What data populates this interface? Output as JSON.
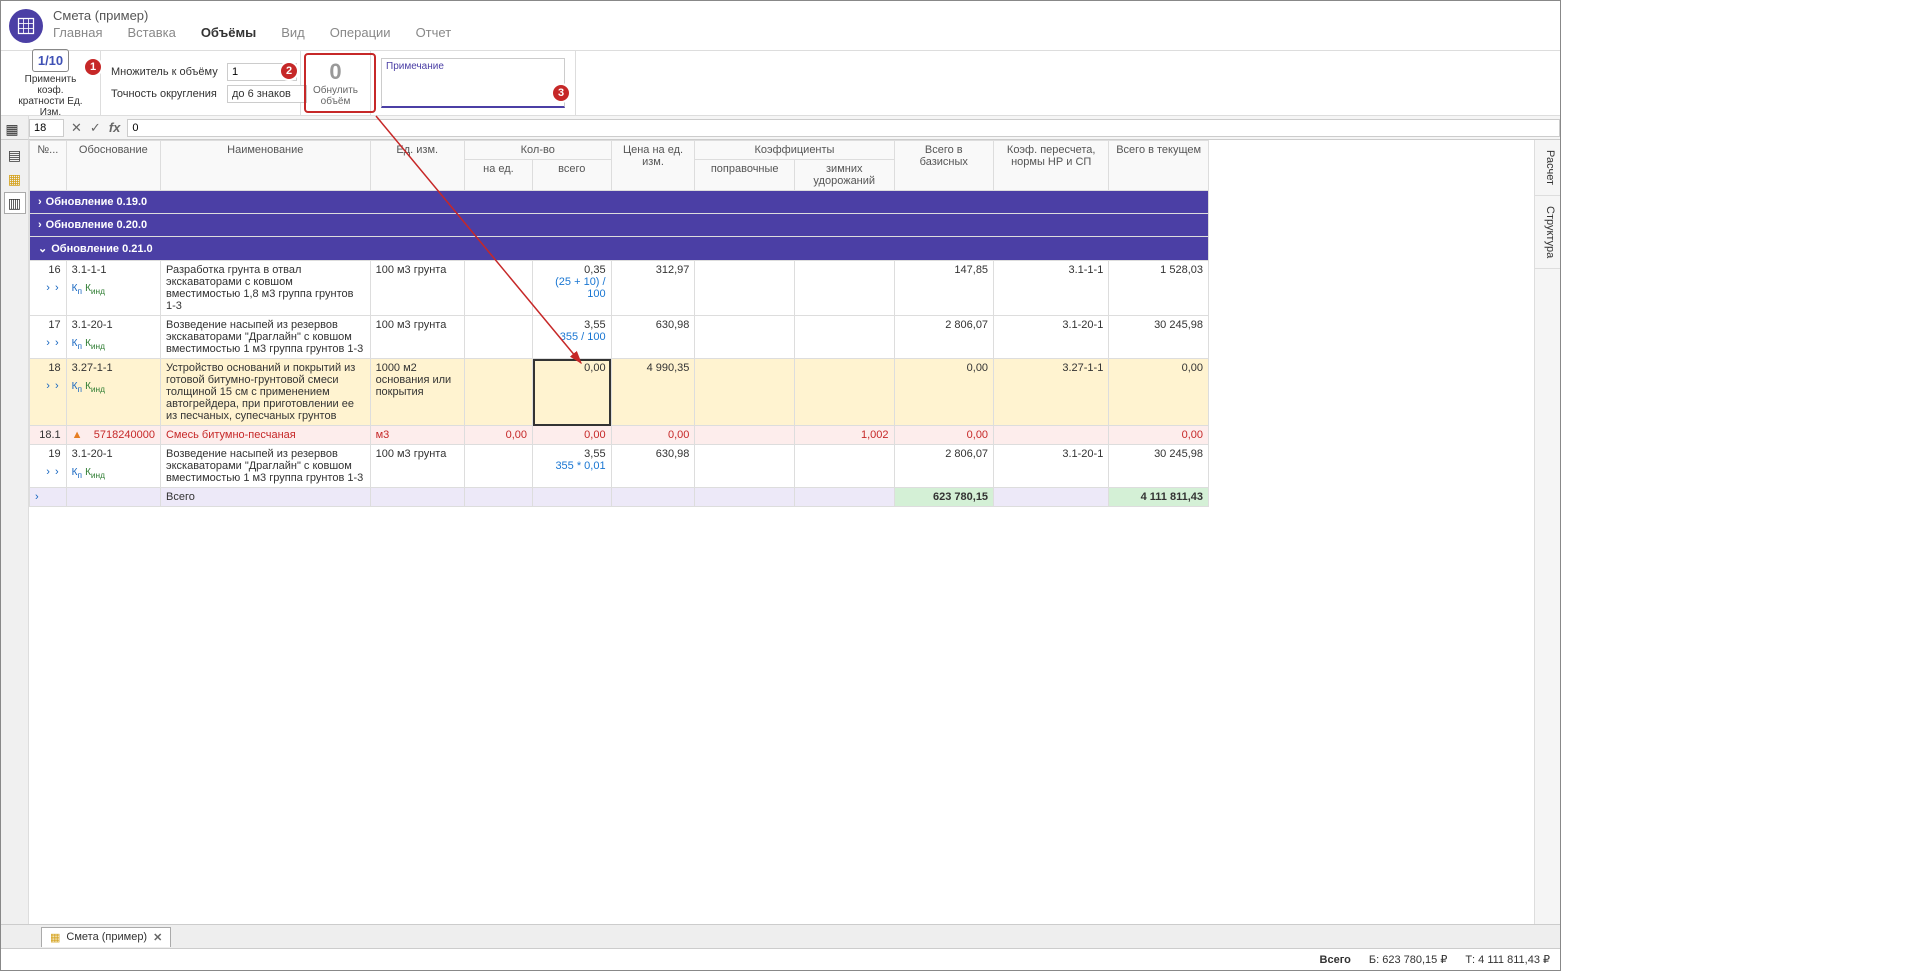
{
  "header": {
    "title": "Смета (пример)",
    "tabs": [
      "Главная",
      "Вставка",
      "Объёмы",
      "Вид",
      "Операции",
      "Отчет"
    ],
    "active_tab": 2
  },
  "ribbon": {
    "apply_coef": {
      "icon": "1/10",
      "label1": "Применить коэф.",
      "label2": "кратности Ед. Изм."
    },
    "multiplier_label": "Множитель к объёму",
    "multiplier_value": "1",
    "precision_label": "Точность округления",
    "precision_value": "до 6 знаков",
    "zero_btn": {
      "icon": "0",
      "label1": "Обнулить",
      "label2": "объём"
    },
    "note_label": "Примечание"
  },
  "badges": {
    "b1": "1",
    "b2": "2",
    "b3": "3"
  },
  "formula_bar": {
    "cell_ref": "18",
    "formula": "0"
  },
  "right_tabs": [
    "Расчет",
    "Структура"
  ],
  "columns": {
    "num": "№...",
    "basis": "Обоснование",
    "name": "Наименование",
    "unit": "Ед. изм.",
    "qty_group": "Кол-во",
    "qty_per": "на ед.",
    "qty_total": "всего",
    "price": "Цена на ед. изм.",
    "coef_group": "Коэффициенты",
    "coef_corr": "поправочные",
    "coef_winter": "зимних удорожаний",
    "total_base": "Всего в базисных",
    "recalc": "Коэф. пересчета, нормы НР и СП",
    "total_curr": "Всего в текущем"
  },
  "groups": [
    {
      "label": "Обновление 0.19.0",
      "expanded": false
    },
    {
      "label": "Обновление 0.20.0",
      "expanded": false
    },
    {
      "label": "Обновление 0.21.0",
      "expanded": true
    }
  ],
  "rows": [
    {
      "num": "16",
      "basis": "3.1-1-1",
      "name": "Разработка грунта в отвал экскаваторами с ковшом вместимостью 1,8 м3 группа грунтов 1-3",
      "unit": "100 м3 грунта",
      "qty_total": "0,35",
      "qty_formula": "(25 + 10) / 100",
      "price": "312,97",
      "total_base": "147,85",
      "recalc": "3.1-1-1",
      "total_curr": "1 528,03",
      "kp": true
    },
    {
      "num": "17",
      "basis": "3.1-20-1",
      "name": "Возведение насыпей из резервов экскаваторами \"Драглайн\" с ковшом вместимостью 1 м3 группа грунтов 1-3",
      "unit": "100 м3 грунта",
      "qty_total": "3,55",
      "qty_formula": "355 / 100",
      "price": "630,98",
      "total_base": "2 806,07",
      "recalc": "3.1-20-1",
      "total_curr": "30 245,98",
      "kp": true
    },
    {
      "num": "18",
      "basis": "3.27-1-1",
      "name": "Устройство оснований и покрытий из готовой битумно-грунтовой смеси толщиной 15 см с применением автогрейдера, при приготовлении ее из песчаных, супесчаных грунтов",
      "unit": "1000 м2 основания или покрытия",
      "qty_total": "0,00",
      "price": "4 990,35",
      "total_base": "0,00",
      "recalc": "3.27-1-1",
      "total_curr": "0,00",
      "hl": true,
      "kp": true,
      "selected": true
    },
    {
      "num": "18.1",
      "basis": "5718240000",
      "name": "Смесь битумно-песчаная",
      "unit": "м3",
      "qty_per": "0,00",
      "qty_total": "0,00",
      "price": "0,00",
      "coef_winter": "1,002",
      "total_base": "0,00",
      "total_curr": "0,00",
      "pink": true,
      "warn": true
    },
    {
      "num": "19",
      "basis": "3.1-20-1",
      "name": "Возведение насыпей из резервов экскаваторами \"Драглайн\" с ковшом вместимостью 1 м3 группа грунтов 1-3",
      "unit": "100 м3 грунта",
      "qty_total": "3,55",
      "qty_formula": "355 * 0,01",
      "price": "630,98",
      "total_base": "2 806,07",
      "recalc": "3.1-20-1",
      "total_curr": "30 245,98",
      "kp": true
    }
  ],
  "total_row": {
    "label": "Всего",
    "total_base": "623 780,15",
    "total_curr": "4 111 811,43"
  },
  "bottom_tab": {
    "label": "Смета (пример)"
  },
  "status": {
    "label": "Всего",
    "base": "Б: 623 780,15 ₽",
    "curr": "Т: 4 111 811,43 ₽"
  }
}
